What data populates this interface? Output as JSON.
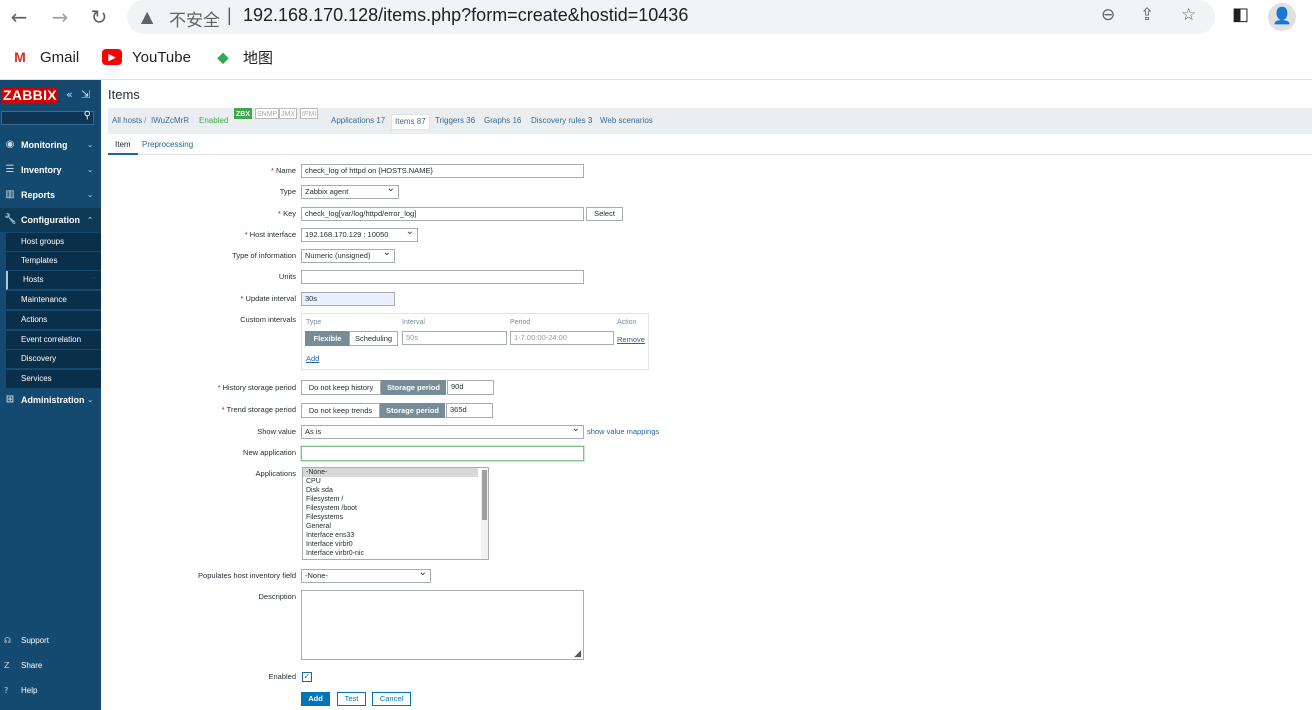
{
  "browser": {
    "security_label": "不安全",
    "separator": "|",
    "url": "192.168.170.128/items.php?form=create&hostid=10436",
    "bookmarks": [
      {
        "label": "Gmail",
        "icon": "gmail-icon"
      },
      {
        "label": "YouTube",
        "icon": "youtube-icon"
      },
      {
        "label": "地图",
        "icon": "maps-icon"
      }
    ]
  },
  "sidebar": {
    "logo": "ZABBIX",
    "menu": [
      {
        "label": "Monitoring",
        "icon": "eye-icon"
      },
      {
        "label": "Inventory",
        "icon": "list-icon"
      },
      {
        "label": "Reports",
        "icon": "bar-chart-icon"
      },
      {
        "label": "Configuration",
        "icon": "wrench-icon"
      },
      {
        "label": "Administration",
        "icon": "admin-icon"
      }
    ],
    "config_items": [
      "Host groups",
      "Templates",
      "Hosts",
      "Maintenance",
      "Actions",
      "Event correlation",
      "Discovery",
      "Services"
    ],
    "footer": [
      {
        "label": "Support",
        "icon": "headset-icon"
      },
      {
        "label": "Share",
        "icon": "share-z-icon"
      },
      {
        "label": "Help",
        "icon": "help-icon"
      }
    ]
  },
  "page": {
    "title": "Items",
    "breadcrumb": {
      "all_hosts": "All hosts",
      "sep": "/",
      "host": "IWuZcMrR",
      "status": "Enabled"
    },
    "badges": [
      "ZBX",
      "SNMP",
      "JMX",
      "IPMI"
    ],
    "host_tabs": [
      "Applications 17",
      "Items 87",
      "Triggers 36",
      "Graphs 16",
      "Discovery rules 3",
      "Web scenarios"
    ],
    "form_tabs": [
      "Item",
      "Preprocessing"
    ]
  },
  "form": {
    "name_label": "Name",
    "name_value": "check_log of httpd on {HOSTS.NAME}",
    "type_label": "Type",
    "type_value": "Zabbix agent",
    "key_label": "Key",
    "key_value": "check_log[var/log/httpd/error_log]",
    "select_button": "Select",
    "host_interface_label": "Host interface",
    "host_interface_value": "192.168.170.129 : 10050",
    "type_info_label": "Type of information",
    "type_info_value": "Numeric (unsigned)",
    "units_label": "Units",
    "units_value": "",
    "update_interval_label": "Update interval",
    "update_interval_value": "30s",
    "custom_intervals_label": "Custom intervals",
    "ci_headers": [
      "Type",
      "Interval",
      "Period",
      "Action"
    ],
    "ci_flexible": "Flexible",
    "ci_scheduling": "Scheduling",
    "ci_interval_placeholder": "50s",
    "ci_period_placeholder": "1-7,00:00-24:00",
    "ci_remove": "Remove",
    "ci_add": "Add",
    "history_label": "History storage period",
    "history_no_keep": "Do not keep history",
    "history_storage": "Storage period",
    "history_value": "90d",
    "trend_label": "Trend storage period",
    "trend_no_keep": "Do not keep trends",
    "trend_storage": "Storage period",
    "trend_value": "365d",
    "show_value_label": "Show value",
    "show_value_value": "As is",
    "show_value_mappings": "show value mappings",
    "new_application_label": "New application",
    "new_application_value": "",
    "applications_label": "Applications",
    "applications": [
      "-None-",
      "CPU",
      "Disk sda",
      "Filesystem /",
      "Filesystem /boot",
      "Filesystems",
      "General",
      "Interface ens33",
      "Interface virbr0",
      "Interface virbr0-nic"
    ],
    "inventory_label": "Populates host inventory field",
    "inventory_value": "-None-",
    "description_label": "Description",
    "description_value": "",
    "enabled_label": "Enabled",
    "enabled_checked": true,
    "actions": {
      "add": "Add",
      "test": "Test",
      "cancel": "Cancel"
    }
  }
}
